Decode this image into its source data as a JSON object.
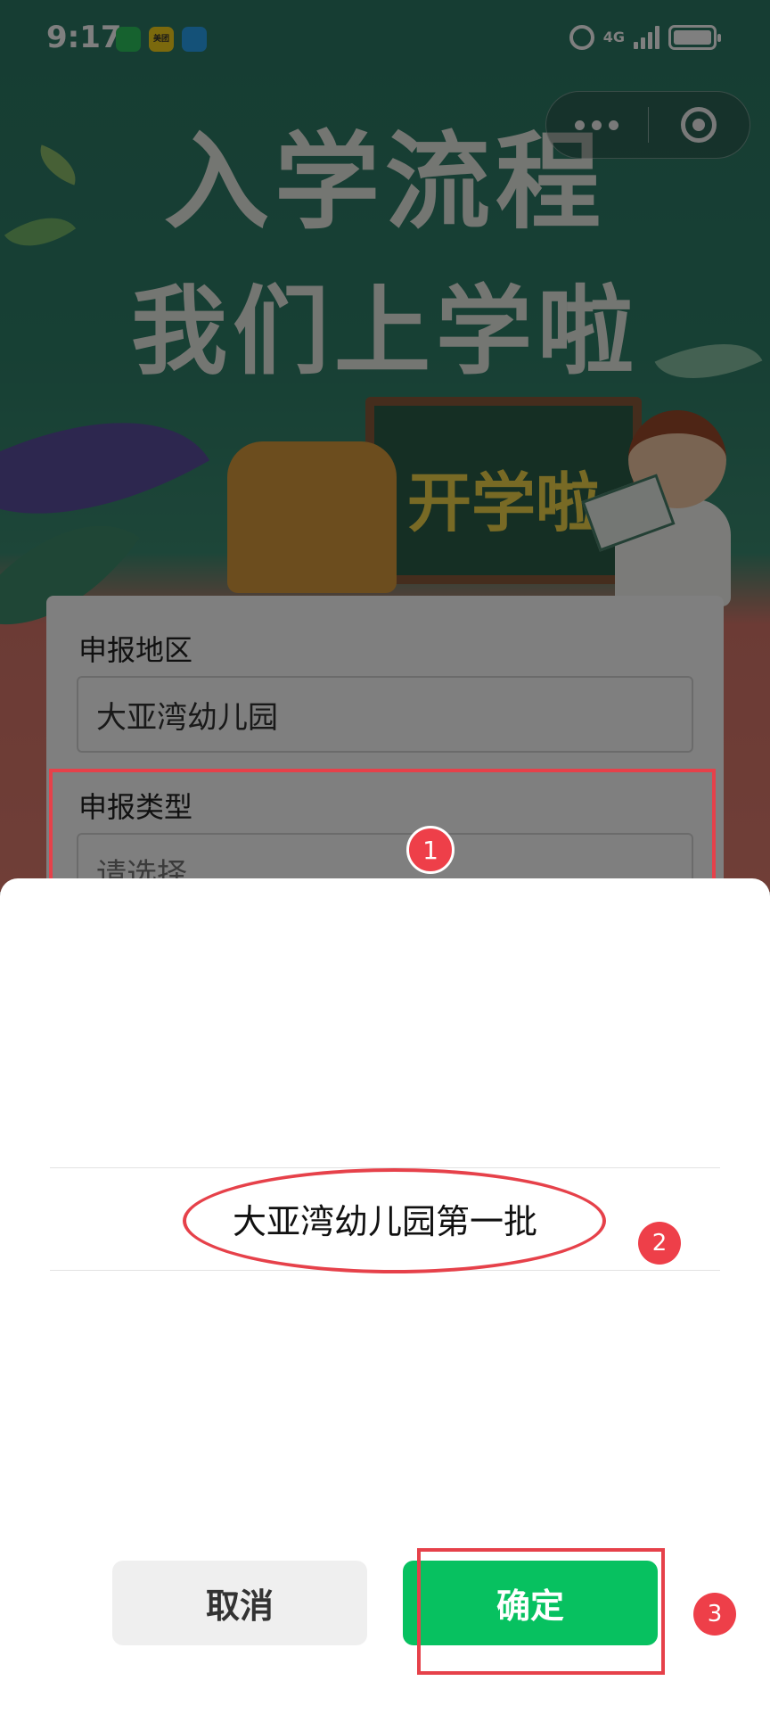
{
  "status_bar": {
    "time": "9:17",
    "network": "4G",
    "apps": [
      "wechat-icon",
      "meituan-icon",
      "message-icon"
    ],
    "meituan_text": "美团"
  },
  "banner": {
    "title_line1": "入学流程",
    "title_line2": "我们上学啦",
    "chalkboard_text": "开学啦"
  },
  "form": {
    "region_label": "申报地区",
    "region_value": "大亚湾幼儿园",
    "type_label": "申报类型",
    "type_placeholder": "请选择"
  },
  "picker": {
    "options": [
      "大亚湾幼儿园第一批"
    ],
    "cancel_label": "取消",
    "confirm_label": "确定"
  },
  "annotations": {
    "step1": "1",
    "step2": "2",
    "step3": "3",
    "color": "#e6414a"
  },
  "colors": {
    "primary_green": "#07c160",
    "banner_green": "#2d7a66"
  }
}
